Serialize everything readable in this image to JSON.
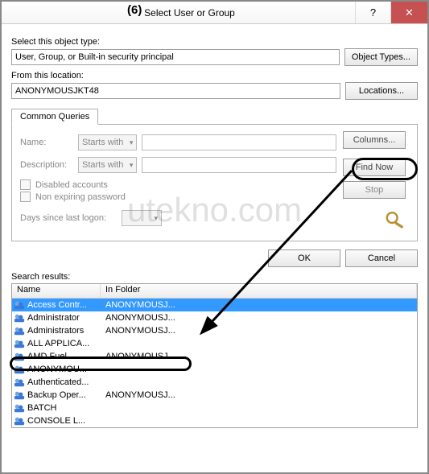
{
  "annotation": {
    "step": "(6)"
  },
  "watermark": "utekno.com",
  "title": "Select User or Group",
  "labels": {
    "object_type": "Select this object type:",
    "location": "From this location:",
    "search_results": "Search results:"
  },
  "fields": {
    "object_type_value": "User, Group, or Built-in security principal",
    "location_value": "ANONYMOUSJKT48"
  },
  "buttons": {
    "object_types": "Object Types...",
    "locations": "Locations...",
    "columns": "Columns...",
    "find_now": "Find Now",
    "stop": "Stop",
    "ok": "OK",
    "cancel": "Cancel"
  },
  "tabs": {
    "common_queries": "Common Queries"
  },
  "queries": {
    "name_label": "Name:",
    "description_label": "Description:",
    "starts_with": "Starts with",
    "disabled_accounts": "Disabled accounts",
    "non_expiring": "Non expiring password",
    "days_label": "Days since last logon:"
  },
  "table": {
    "col_name": "Name",
    "col_folder": "In Folder",
    "rows": [
      {
        "name": "Access Contr...",
        "folder": "ANONYMOUSJ...",
        "selected": true
      },
      {
        "name": "Administrator",
        "folder": "ANONYMOUSJ..."
      },
      {
        "name": "Administrators",
        "folder": "ANONYMOUSJ..."
      },
      {
        "name": "ALL APPLICA...",
        "folder": ""
      },
      {
        "name": "AMD Fuel",
        "folder": "ANONYMOUSJ..."
      },
      {
        "name": "ANONYMOU...",
        "folder": ""
      },
      {
        "name": "Authenticated...",
        "folder": ""
      },
      {
        "name": "Backup Oper...",
        "folder": "ANONYMOUSJ..."
      },
      {
        "name": "BATCH",
        "folder": ""
      },
      {
        "name": "CONSOLE L...",
        "folder": ""
      }
    ]
  }
}
